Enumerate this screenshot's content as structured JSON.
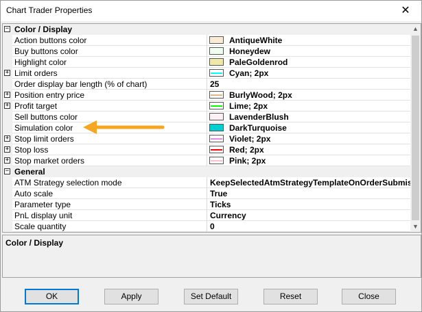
{
  "window": {
    "title": "Chart Trader Properties",
    "close_glyph": "✕"
  },
  "grid": {
    "categories": [
      {
        "label": "Color / Display",
        "expander": "−"
      },
      {
        "label": "General",
        "expander": "−"
      }
    ],
    "rows": [
      {
        "name": "Action buttons color",
        "value": "AntiqueWhite",
        "swatch": "#FAEBD7",
        "line": "",
        "expander": ""
      },
      {
        "name": "Buy buttons color",
        "value": "Honeydew",
        "swatch": "#F0FFF0",
        "line": "",
        "expander": ""
      },
      {
        "name": "Highlight color",
        "value": "PaleGoldenrod",
        "swatch": "#EEE8AA",
        "line": "",
        "expander": ""
      },
      {
        "name": "Limit orders",
        "value": "Cyan; 2px",
        "swatch": "#ffffff",
        "line": "#00FFFF",
        "expander": "+"
      },
      {
        "name": "Order display bar length (% of chart)",
        "value": "25",
        "swatch": "",
        "line": "",
        "expander": ""
      },
      {
        "name": "Position entry price",
        "value": "BurlyWood; 2px",
        "swatch": "#ffffff",
        "line": "#DEB887",
        "expander": "+"
      },
      {
        "name": "Profit target",
        "value": "Lime; 2px",
        "swatch": "#ffffff",
        "line": "#00FF00",
        "expander": "+"
      },
      {
        "name": "Sell buttons color",
        "value": "LavenderBlush",
        "swatch": "#FFF0F5",
        "line": "",
        "expander": ""
      },
      {
        "name": "Simulation color",
        "value": "DarkTurquoise",
        "swatch": "#00CED1",
        "line": "",
        "expander": ""
      },
      {
        "name": "Stop limit orders",
        "value": "Violet; 2px",
        "swatch": "#ffffff",
        "line": "#EE82EE",
        "expander": "+"
      },
      {
        "name": "Stop loss",
        "value": "Red; 2px",
        "swatch": "#ffffff",
        "line": "#FF0000",
        "expander": "+"
      },
      {
        "name": "Stop market orders",
        "value": "Pink; 2px",
        "swatch": "#ffffff",
        "line": "#FFC0CB",
        "expander": "+"
      },
      {
        "name": "ATM Strategy selection mode",
        "value": "KeepSelectedAtmStrategyTemplateOnOrderSubmission",
        "swatch": "",
        "line": "",
        "expander": ""
      },
      {
        "name": "Auto scale",
        "value": "True",
        "swatch": "",
        "line": "",
        "expander": ""
      },
      {
        "name": "Parameter type",
        "value": "Ticks",
        "swatch": "",
        "line": "",
        "expander": ""
      },
      {
        "name": "PnL display unit",
        "value": "Currency",
        "swatch": "",
        "line": "",
        "expander": ""
      },
      {
        "name": "Scale quantity",
        "value": "0",
        "swatch": "",
        "line": "",
        "expander": ""
      }
    ]
  },
  "description": {
    "title": "Color / Display"
  },
  "buttons": {
    "ok": "OK",
    "apply": "Apply",
    "set_default": "Set Default",
    "reset": "Reset",
    "close": "Close"
  },
  "colors": {
    "arrow": "#F5A623",
    "accent": "#0078d7"
  },
  "icons": {
    "scroll_up": "chevron-up-icon",
    "scroll_down": "chevron-down-icon",
    "annotation": "arrow-left-icon"
  }
}
